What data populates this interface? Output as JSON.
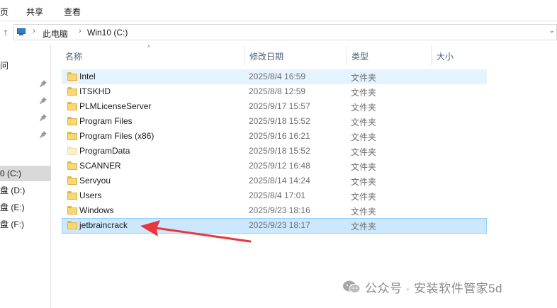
{
  "ribbon": {
    "tabs": [
      "页",
      "共享",
      "查看"
    ]
  },
  "address_bar": {
    "crumbs": [
      "此电脑",
      "Win10 (C:)"
    ],
    "separator": "›"
  },
  "nav_pane": {
    "items": [
      {
        "label": "问",
        "pinned": false
      },
      {
        "label": "",
        "pinned": true
      },
      {
        "label": "",
        "pinned": true
      },
      {
        "label": "",
        "pinned": true
      },
      {
        "label": "",
        "pinned": true
      },
      {
        "label": "0 (C:)",
        "selected": true
      },
      {
        "label": "盘 (D:)"
      },
      {
        "label": "盘 (E:)"
      },
      {
        "label": "盘 (F:)"
      }
    ]
  },
  "columns": {
    "name": "名称",
    "date": "修改日期",
    "type": "类型",
    "size": "大小"
  },
  "files": [
    {
      "name": "Intel",
      "date": "2025/8/4 16:59",
      "type": "文件夹",
      "state": "hover"
    },
    {
      "name": "ITSKHD",
      "date": "2025/8/8 12:59",
      "type": "文件夹"
    },
    {
      "name": "PLMLicenseServer",
      "date": "2025/9/17 15:57",
      "type": "文件夹"
    },
    {
      "name": "Program Files",
      "date": "2025/9/18 15:52",
      "type": "文件夹"
    },
    {
      "name": "Program Files (x86)",
      "date": "2025/9/16 16:21",
      "type": "文件夹"
    },
    {
      "name": "ProgramData",
      "date": "2025/9/18 15:52",
      "type": "文件夹",
      "hidden": true
    },
    {
      "name": "SCANNER",
      "date": "2025/9/12 16:48",
      "type": "文件夹"
    },
    {
      "name": "Servyou",
      "date": "2025/8/14 14:24",
      "type": "文件夹"
    },
    {
      "name": "Users",
      "date": "2025/8/4 17:01",
      "type": "文件夹"
    },
    {
      "name": "Windows",
      "date": "2025/9/23 18:16",
      "type": "文件夹"
    },
    {
      "name": "jetbraincrack",
      "date": "2025/9/23 18:17",
      "type": "文件夹",
      "state": "selected"
    }
  ],
  "watermark": {
    "text": "公众号 · 安装软件管家5d"
  },
  "colors": {
    "selected_row_bg": "#cce8ff",
    "selected_row_border": "#99d1ff",
    "hover_row_bg": "#e5f3ff",
    "arrow_red": "#e8373c",
    "folder_yellow": "#f8d775"
  }
}
